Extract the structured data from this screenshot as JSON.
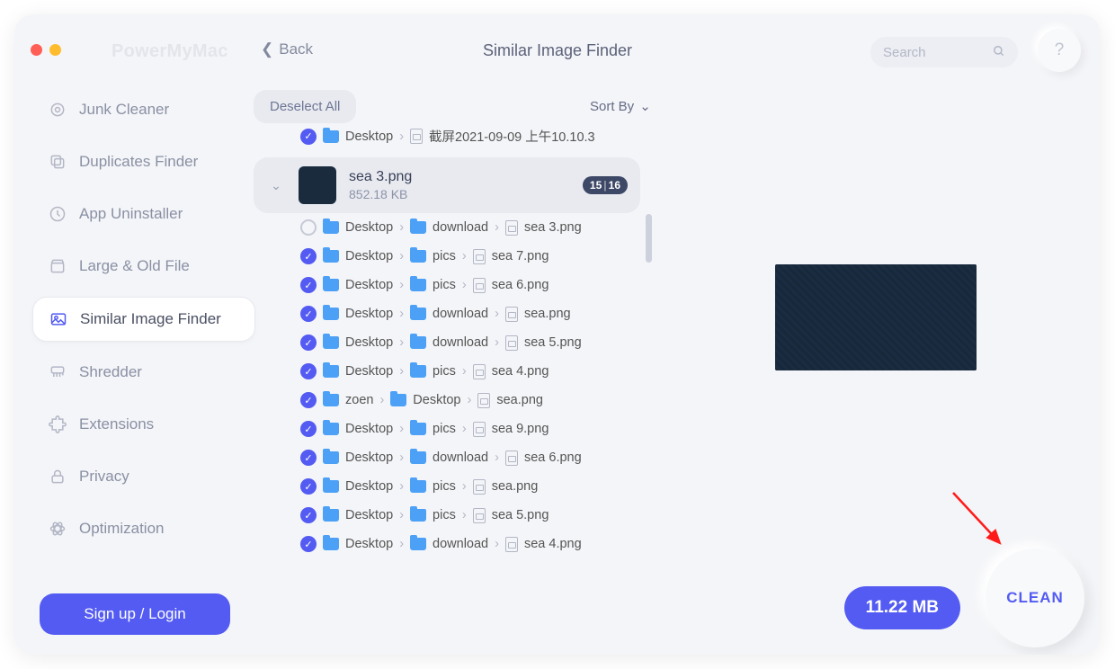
{
  "brand": "PowerMyMac",
  "back_label": "Back",
  "page_title": "Similar Image Finder",
  "search": {
    "placeholder": "Search"
  },
  "help_label": "?",
  "sidebar": {
    "items": [
      {
        "label": "Junk Cleaner"
      },
      {
        "label": "Duplicates Finder"
      },
      {
        "label": "App Uninstaller"
      },
      {
        "label": "Large & Old File"
      },
      {
        "label": "Similar Image Finder"
      },
      {
        "label": "Shredder"
      },
      {
        "label": "Extensions"
      },
      {
        "label": "Privacy"
      },
      {
        "label": "Optimization"
      }
    ]
  },
  "toolbar": {
    "deselect_label": "Deselect All",
    "sort_label": "Sort By"
  },
  "truncated_row": {
    "segments": [
      "Desktop",
      "截屏2021-09-09 上午10.10.3"
    ]
  },
  "group": {
    "name": "sea 3.png",
    "size": "852.18 KB",
    "badge_selected": "15",
    "badge_total": "16"
  },
  "paths": [
    {
      "checked": false,
      "segments": [
        "Desktop",
        "download",
        "sea 3.png"
      ]
    },
    {
      "checked": true,
      "segments": [
        "Desktop",
        "pics",
        "sea 7.png"
      ]
    },
    {
      "checked": true,
      "segments": [
        "Desktop",
        "pics",
        "sea 6.png"
      ]
    },
    {
      "checked": true,
      "segments": [
        "Desktop",
        "download",
        "sea.png"
      ]
    },
    {
      "checked": true,
      "segments": [
        "Desktop",
        "download",
        "sea 5.png"
      ]
    },
    {
      "checked": true,
      "segments": [
        "Desktop",
        "pics",
        "sea 4.png"
      ]
    },
    {
      "checked": true,
      "segments": [
        "zoen",
        "Desktop",
        "sea.png"
      ]
    },
    {
      "checked": true,
      "segments": [
        "Desktop",
        "pics",
        "sea 9.png"
      ]
    },
    {
      "checked": true,
      "segments": [
        "Desktop",
        "download",
        "sea 6.png"
      ]
    },
    {
      "checked": true,
      "segments": [
        "Desktop",
        "pics",
        "sea.png"
      ]
    },
    {
      "checked": true,
      "segments": [
        "Desktop",
        "pics",
        "sea 5.png"
      ]
    },
    {
      "checked": true,
      "segments": [
        "Desktop",
        "download",
        "sea 4.png"
      ]
    }
  ],
  "footer": {
    "signup_label": "Sign up / Login",
    "total_size": "11.22 MB",
    "clean_label": "CLEAN"
  },
  "glyphs": {
    "chevron": "›",
    "check": "✓",
    "down": "⌄"
  }
}
